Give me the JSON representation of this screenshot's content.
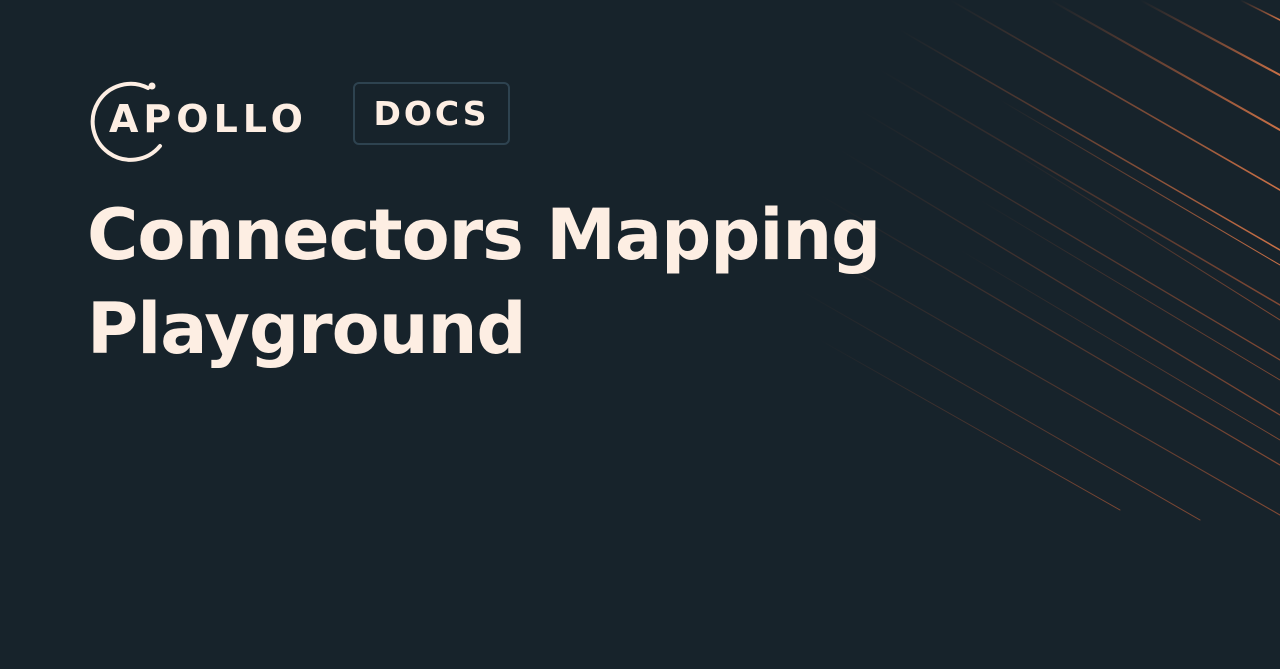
{
  "brand": {
    "name": "APOLLO",
    "badge": "DOCS"
  },
  "title": {
    "line1": "Connectors Mapping",
    "line2": "Playground"
  },
  "colors": {
    "background": "#17232b",
    "text": "#fdeee3",
    "badge_border": "#2e4350",
    "accent_lines": "#c2623a"
  },
  "icons": {
    "logo": "apollo-ring-icon"
  }
}
